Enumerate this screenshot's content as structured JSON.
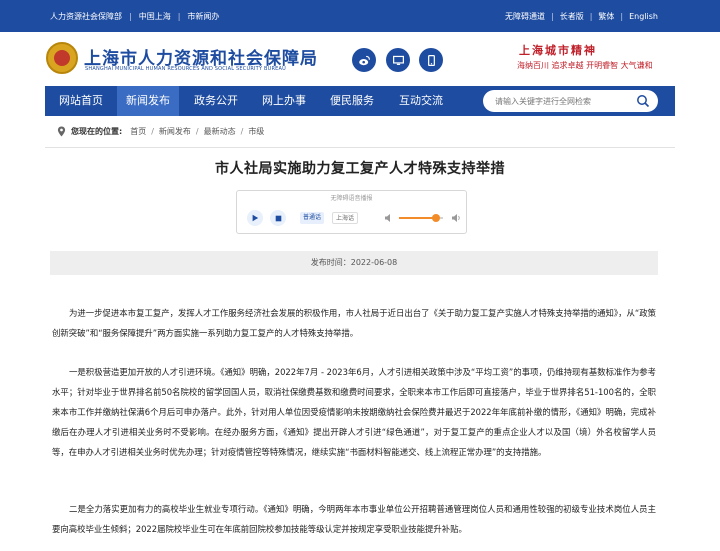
{
  "topbar": {
    "links_left": [
      "人力资源社会保障部",
      "中国上海",
      "市新闻办"
    ],
    "links_right": [
      "无障碍通道",
      "长者版",
      "繁体",
      "English"
    ]
  },
  "header": {
    "site_title": "上海市人力资源和社会保障局",
    "site_subtitle": "SHANGHAI MUNICIPAL HUMAN RESOURCES AND SOCIAL SECURITY BUREAU",
    "social_icons": [
      "weibo-icon",
      "desktop-icon",
      "mobile-icon"
    ],
    "spirit_title": "上海城市精神",
    "spirit_subtitle": "海纳百川  追求卓越  开明睿智  大气谦和"
  },
  "nav": {
    "items": [
      "网站首页",
      "新闻发布",
      "政务公开",
      "网上办事",
      "便民服务",
      "互动交流"
    ],
    "active_index": 1
  },
  "search": {
    "placeholder": "请输入关键字进行全网检索"
  },
  "breadcrumb": {
    "label": "您现在的位置:",
    "items": [
      "首页",
      "新闻发布",
      "最新动态",
      "市级"
    ]
  },
  "article": {
    "title": "市人社局实施助力复工复产人才特殊支持举措",
    "publish_time": "发布时间：2022-06-08",
    "paragraphs": [
      "为进一步促进本市复工复产，发挥人才工作服务经济社会发展的积极作用，市人社局于近日出台了《关于助力复工复产实施人才特殊支持举措的通知》，从“政策创新突破”和“服务保障提升”两方面实施一系列助力复工复产的人才特殊支持举措。",
      "一是积极营造更加开放的人才引进环境。《通知》明确，2022年7月 - 2023年6月，人才引进相关政策中涉及“平均工资”的事项，仍维持现有基数标准作为参考水平；针对毕业于世界排名前50名院校的留学回国人员，取消社保缴费基数和缴费时间要求，全职来本市工作后即可直接落户，毕业于世界排名51-100名的，全职来本市工作并缴纳社保满6个月后可申办落户。此外，针对用人单位因受疫情影响未按期缴纳社会保险费并最迟于2022年年底前补缴的情形，《通知》明确，完成补缴后在办理人才引进相关业务时不受影响。在经办服务方面，《通知》提出开辟人才引进“绿色通道”，对于复工复产的重点企业人才以及国（境）外名校留学人员等，在申办人才引进相关业务时优先办理；针对疫情管控等特殊情况，继续实施“书面材料智能递交、线上流程正常办理”的支持措施。",
      "二是全力落实更加有力的高校毕业生就业专项行动。《通知》明确，今明两年本市事业单位公开招聘普通管理岗位人员和通用性较强的初级专业技术岗位人员主要向高校毕业生倾斜；2022届院校毕业生可在年底前回院校参加技能等级认定并按规定享受职业技能提升补贴。"
    ]
  },
  "player": {
    "tag": "无障碍语音播报",
    "lang_active": "普通话",
    "lang_other": "上海话",
    "volume_level": 0.85
  },
  "colors": {
    "brand_blue": "#1e4ca0",
    "nav_active": "#3b6cc4",
    "spirit_red": "#c0202a",
    "slider_orange": "#f28c28"
  }
}
